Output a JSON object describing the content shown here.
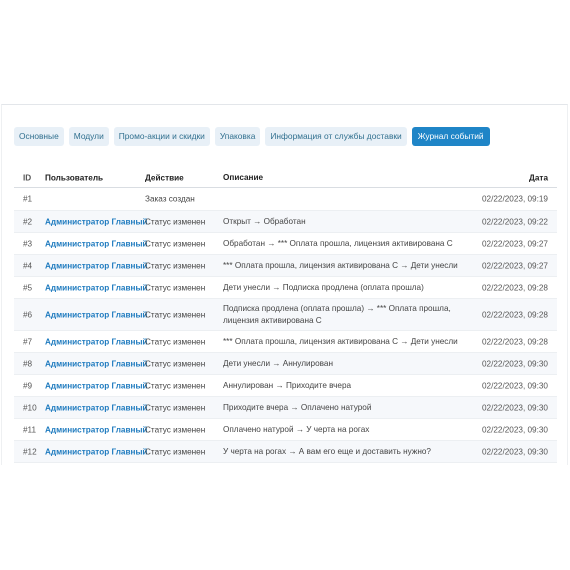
{
  "tabs": [
    {
      "label": "Основные",
      "active": false
    },
    {
      "label": "Модули",
      "active": false
    },
    {
      "label": "Промо-акции и скидки",
      "active": false
    },
    {
      "label": "Упаковка",
      "active": false
    },
    {
      "label": "Информация от службы доставки",
      "active": false
    },
    {
      "label": "Журнал событий",
      "active": true
    }
  ],
  "table": {
    "headers": {
      "id": "ID",
      "user": "Пользователь",
      "action": "Действие",
      "description": "Описание",
      "date": "Дата"
    },
    "rows": [
      {
        "id": "#1",
        "user": "",
        "action": "Заказ создан",
        "description": "",
        "date": "02/22/2023, 09:19"
      },
      {
        "id": "#2",
        "user": "Администратор Главный",
        "action": "Статус изменен",
        "description": "Открыт → Обработан",
        "date": "02/22/2023, 09:22"
      },
      {
        "id": "#3",
        "user": "Администратор Главный",
        "action": "Статус изменен",
        "description": "Обработан → *** Оплата прошла, лицензия активирована С",
        "date": "02/22/2023, 09:27"
      },
      {
        "id": "#4",
        "user": "Администратор Главный",
        "action": "Статус изменен",
        "description": "*** Оплата прошла, лицензия активирована С → Дети унесли",
        "date": "02/22/2023, 09:27"
      },
      {
        "id": "#5",
        "user": "Администратор Главный",
        "action": "Статус изменен",
        "description": "Дети унесли → Подписка продлена (оплата прошла)",
        "date": "02/22/2023, 09:28"
      },
      {
        "id": "#6",
        "user": "Администратор Главный",
        "action": "Статус изменен",
        "description": "Подписка продлена (оплата прошла) → *** Оплата прошла, лицензия активирована С",
        "date": "02/22/2023, 09:28"
      },
      {
        "id": "#7",
        "user": "Администратор Главный",
        "action": "Статус изменен",
        "description": "*** Оплата прошла, лицензия активирована С → Дети унесли",
        "date": "02/22/2023, 09:28"
      },
      {
        "id": "#8",
        "user": "Администратор Главный",
        "action": "Статус изменен",
        "description": "Дети унесли → Аннулирован",
        "date": "02/22/2023, 09:30"
      },
      {
        "id": "#9",
        "user": "Администратор Главный",
        "action": "Статус изменен",
        "description": "Аннулирован → Приходите вчера",
        "date": "02/22/2023, 09:30"
      },
      {
        "id": "#10",
        "user": "Администратор Главный",
        "action": "Статус изменен",
        "description": "Приходите вчера → Оплачено натурой",
        "date": "02/22/2023, 09:30"
      },
      {
        "id": "#11",
        "user": "Администратор Главный",
        "action": "Статус изменен",
        "description": "Оплачено натурой → У черта на рогах",
        "date": "02/22/2023, 09:30"
      },
      {
        "id": "#12",
        "user": "Администратор Главный",
        "action": "Статус изменен",
        "description": "У черта на рогах → А вам его еще и доставить нужно?",
        "date": "02/22/2023, 09:30"
      }
    ]
  }
}
